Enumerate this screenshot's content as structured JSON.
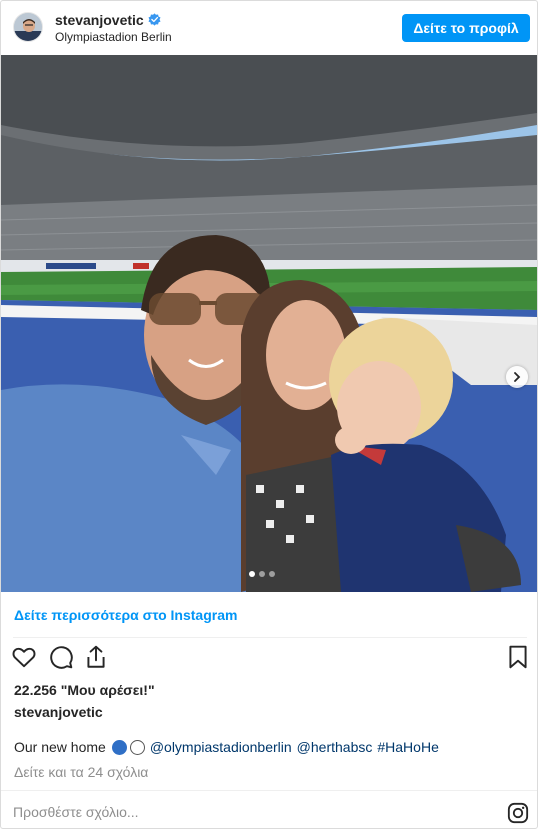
{
  "header": {
    "username": "stevanjovetic",
    "location": "Olympiastadion Berlin",
    "profile_button": "Δείτε το προφίλ"
  },
  "post": {
    "more_link": "Δείτε περισσότερα στο Instagram",
    "likes": "22.256 \"Μου αρέσει!\"",
    "caption_username": "stevanjovetic",
    "caption_text": "Our new home",
    "mention_1": "@olympiastadionberlin",
    "mention_2": "@herthabsc",
    "hashtag": "#HaHoHe",
    "view_comments": "Δείτε και τα 24 σχόλια",
    "comment_placeholder": "Προσθέστε σχόλιο..."
  },
  "carousel": {
    "slide_count": 3,
    "active_index": 0
  },
  "colors": {
    "accent": "#0095f6",
    "text": "#262626",
    "muted": "#8e8e8e",
    "link_dark": "#00376b"
  },
  "icons": [
    "verified-badge-icon",
    "chevron-right-icon",
    "heart-icon",
    "comment-icon",
    "share-icon",
    "bookmark-icon",
    "instagram-logo-icon"
  ]
}
